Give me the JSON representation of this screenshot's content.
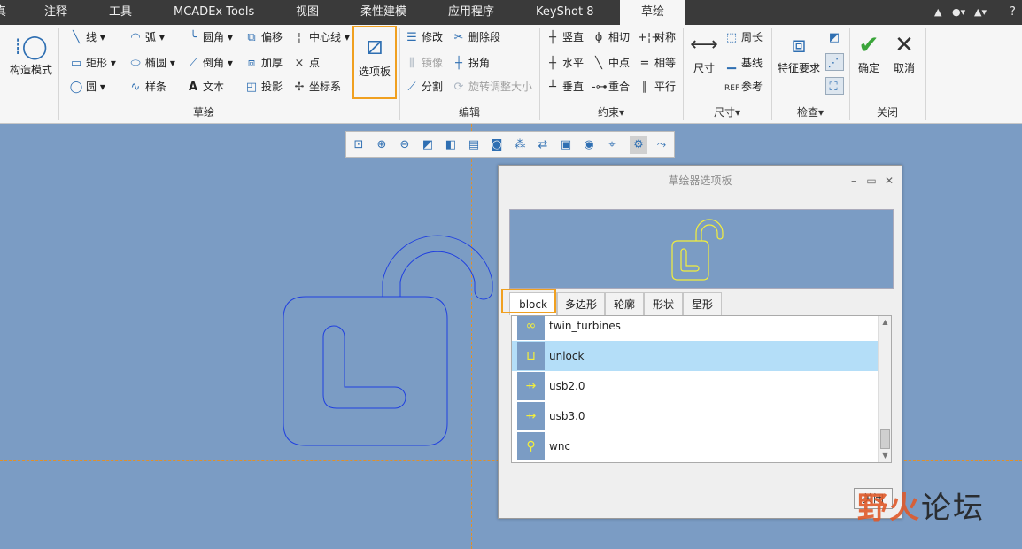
{
  "menubar": {
    "tabs": [
      "真",
      "注释",
      "工具",
      "MCADEx Tools",
      "视图",
      "柔性建模",
      "应用程序",
      "KeyShot 8",
      "草绘"
    ],
    "active": "草绘",
    "right_icons": [
      "chevron-up-icon",
      "help-icon"
    ]
  },
  "ribbon": {
    "setup": {
      "label": "构造模式"
    },
    "sketch_col1": [
      "线",
      "矩形",
      "圆"
    ],
    "sketch_col2": [
      "弧",
      "椭圆",
      "样条"
    ],
    "sketch_col3": [
      "圆角",
      "倒角",
      "文本"
    ],
    "sketch_col4": [
      "偏移",
      "加厚",
      "投影"
    ],
    "sketch_col5": [
      "中心线",
      "点",
      "坐标系"
    ],
    "palette_label": "选项板",
    "sketch_group": "草绘",
    "edit_col1": [
      "修改",
      "镜像",
      "分割"
    ],
    "edit_col2": [
      "删除段",
      "拐角",
      "旋转调整大小"
    ],
    "edit_group": "编辑",
    "constraint_col1": [
      "竖直",
      "水平",
      "垂直"
    ],
    "constraint_col2": [
      "相切",
      "中点",
      "重合"
    ],
    "constraint_col3": [
      "对称",
      "相等",
      "平行"
    ],
    "constraint_group": "约束",
    "dim_big": "尺寸",
    "dim_col": [
      "周长",
      "基线",
      "参考"
    ],
    "dim_group": "尺寸",
    "inspect_big": "特征要求",
    "inspect_group": "检查",
    "ok_label": "确定",
    "cancel_label": "取消",
    "close_group": "关闭"
  },
  "dialog": {
    "title": "草绘器选项板",
    "tabs": [
      "block",
      "多边形",
      "轮廓",
      "形状",
      "星形"
    ],
    "active_tab": "block",
    "items": [
      {
        "label": "twin_turbines",
        "icon": "twin-turbines-icon"
      },
      {
        "label": "unlock",
        "icon": "unlock-icon",
        "selected": true
      },
      {
        "label": "usb2.0",
        "icon": "usb-icon"
      },
      {
        "label": "usb3.0",
        "icon": "usb3-icon"
      },
      {
        "label": "wnc",
        "icon": "wnc-icon"
      }
    ],
    "close_label": "关闭"
  },
  "watermark": {
    "text1": "野火",
    "text2": "论坛"
  },
  "colors": {
    "canvas": "#7b9cc4",
    "highlight": "#f0a020",
    "sketch_line": "#1f3fe0",
    "selected_row": "#b4def8",
    "preview_line": "#f4ef3a"
  }
}
